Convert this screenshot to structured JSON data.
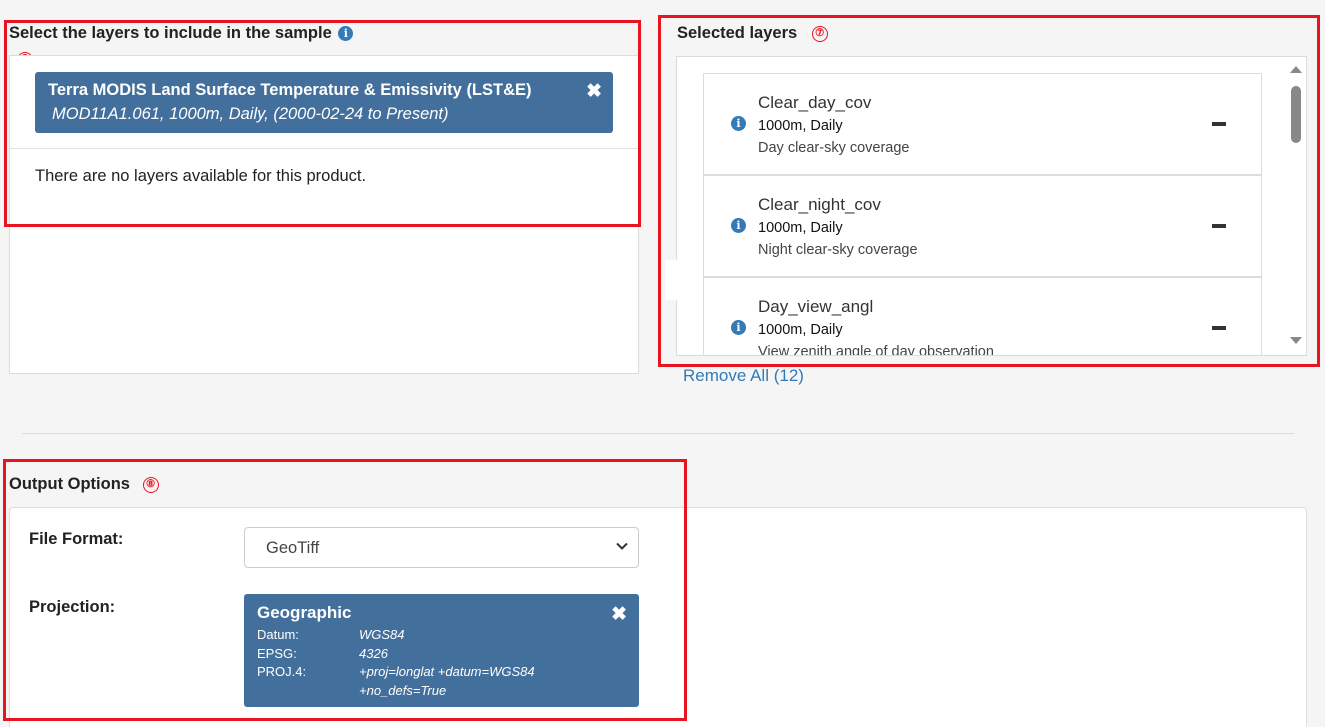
{
  "select_section": {
    "heading": "Select the layers to include in the sample",
    "marker": "⑥",
    "product": {
      "title": "Terra MODIS Land Surface Temperature & Emissivity (LST&E)",
      "subtitle": "MOD11A1.061, 1000m, Daily, (2000-02-24 to Present)"
    },
    "empty_message": "There are no layers available for this product."
  },
  "selected_section": {
    "heading": "Selected layers",
    "marker": "⑦",
    "layers": [
      {
        "name": "Clear_day_cov",
        "resolution": "1000m, Daily",
        "description": "Day clear-sky coverage"
      },
      {
        "name": "Clear_night_cov",
        "resolution": "1000m, Daily",
        "description": "Night clear-sky coverage"
      },
      {
        "name": "Day_view_angl",
        "resolution": "1000m, Daily",
        "description": "View zenith angle of day observation"
      }
    ],
    "remove_all": "Remove All (12)"
  },
  "output_section": {
    "heading": "Output Options",
    "marker": "⑧",
    "file_format_label": "File Format:",
    "file_format_value": "GeoTiff",
    "projection_label": "Projection:",
    "projection": {
      "name": "Geographic",
      "datum_label": "Datum:",
      "datum_value": "WGS84",
      "epsg_label": "EPSG:",
      "epsg_value": "4326",
      "proj4_label": "PROJ.4:",
      "proj4_value_line1": "+proj=longlat +datum=WGS84",
      "proj4_value_line2": "+no_defs=True"
    }
  },
  "colors": {
    "chip": "#436f9c",
    "link": "#337ab7",
    "annotation": "#e8141f"
  }
}
